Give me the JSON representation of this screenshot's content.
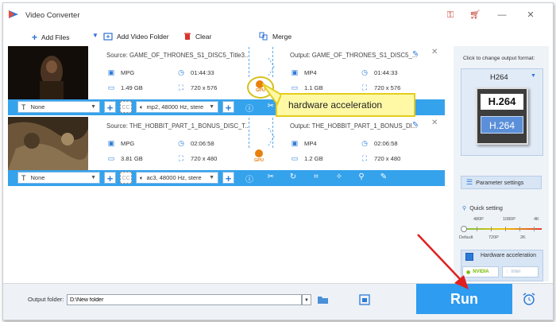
{
  "app": {
    "title": "Video Converter"
  },
  "toolbar": {
    "add_files": "Add Files",
    "add_video_folder": "Add Video Folder",
    "clear": "Clear",
    "merge": "Merge"
  },
  "files": [
    {
      "source": "Source: GAME_OF_THRONES_S1_DISC5_Title3...",
      "output": "Output: GAME_OF_THRONES_S1_DISC5_...",
      "src_format": "MPG",
      "src_duration": "01:44:33",
      "src_size": "1.49 GB",
      "src_res": "720 x 576",
      "out_format": "MP4",
      "out_duration": "01:44:33",
      "out_size": "1.1 GB",
      "out_res": "720 x 576",
      "gpu_label": "GPU",
      "subtitle": "None",
      "audio": "mp2, 48000 Hz, stere"
    },
    {
      "source": "Source: THE_HOBBIT_PART_1_BONUS_DISC_T...",
      "output": "Output: THE_HOBBIT_PART_1_BONUS_DI...",
      "src_format": "MPG",
      "src_duration": "02:06:58",
      "src_size": "3.81 GB",
      "src_res": "720 x 480",
      "out_format": "MP4",
      "out_duration": "02:06:58",
      "out_size": "1.2 GB",
      "out_res": "720 x 480",
      "gpu_label": "GPU",
      "subtitle": "None",
      "audio": "ac3, 48000 Hz, stere"
    }
  ],
  "cc_label": "CC",
  "callout": "hardware acceleration",
  "right_panel": {
    "hint": "Click to change output format:",
    "format": "H264",
    "badge_top": "H.264",
    "badge_bottom": "H.264",
    "parameter_settings": "Parameter settings",
    "quick_setting": "Quick setting",
    "quality_top": [
      "480P",
      "1080P",
      "4K"
    ],
    "quality_bottom": [
      "Default",
      "720P",
      "2K"
    ],
    "quality_level": 0,
    "hardware_acceleration": "Hardware acceleration",
    "nvidia": "NVIDIA",
    "intel": "Intel"
  },
  "bottom": {
    "output_folder_label": "Output folder:",
    "output_folder_value": "D:\\New folder",
    "run": "Run"
  },
  "colors": {
    "accent_blue": "#35a2ec",
    "run_blue": "#2e9cf0",
    "callout_yellow": "#fff9a6",
    "gpu_orange": "#e8800c",
    "arrow_red": "#e02020",
    "nvidia_green": "#76b900"
  }
}
